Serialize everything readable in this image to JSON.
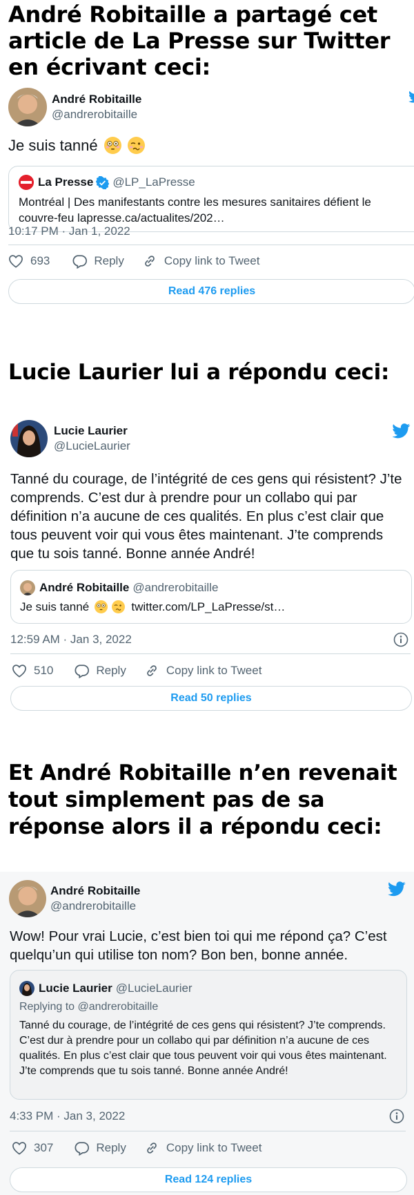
{
  "captions": {
    "first": "André Robitaille a partagé cet article de La Presse sur Twitter en écrivant ceci:",
    "second": "Lucie Laurier lui a répondu ceci:",
    "third": "Et André Robitaille n’en revenait tout simplement pas de sa réponse alors il a répondu ceci:"
  },
  "tweet1": {
    "name": "André Robitaille",
    "handle": "@andrerobitaille",
    "text": "Je suis tanné",
    "quote": {
      "name": "La Presse",
      "handle": "@LP_LaPresse",
      "text": "Montréal | Des manifestants contre les mesures sanitaires défient le couvre-feu lapresse.ca/actualites/202…"
    },
    "timestamp": "10:17 PM · Jan 1, 2022",
    "likes": "693",
    "reply_label": "Reply",
    "copy_label": "Copy link to Tweet",
    "read_label": "Read 476 replies"
  },
  "tweet2": {
    "name": "Lucie Laurier",
    "handle": "@LucieLaurier",
    "text": "Tanné du courage, de l’intégrité de ces gens qui résistent? J’te comprends. C’est dur à prendre pour un collabo qui par définition n’a aucune de ces qualités. En plus c’est clair que tous peuvent voir qui vous êtes maintenant. J’te comprends que tu sois tanné. Bonne année André!",
    "quote": {
      "name": "André Robitaille",
      "handle": "@andrerobitaille",
      "text_before": "Je suis tanné",
      "link": "twitter.com/LP_LaPresse/st…"
    },
    "timestamp": "12:59 AM · Jan 3, 2022",
    "likes": "510",
    "reply_label": "Reply",
    "copy_label": "Copy link to Tweet",
    "read_label": "Read 50 replies"
  },
  "tweet3": {
    "name": "André Robitaille",
    "handle": "@andrerobitaille",
    "text": "Wow! Pour vrai Lucie, c’est bien toi qui me répond ça? C’est quelqu’un qui utilise ton nom? Bon ben, bonne année.",
    "quote": {
      "name": "Lucie Laurier",
      "handle": "@LucieLaurier",
      "replying": "Replying to @andrerobitaille",
      "text": "Tanné du courage, de l’intégrité de ces gens qui résistent? J’te comprends. C’est dur à prendre pour un collabo qui par définition n’a aucune de ces qualités. En plus c’est clair que tous peuvent voir qui vous êtes maintenant. J’te comprends que tu sois tanné. Bonne année André!"
    },
    "timestamp": "4:33 PM · Jan 3, 2022",
    "likes": "307",
    "reply_label": "Reply",
    "copy_label": "Copy link to Tweet",
    "read_label": "Read 124 replies"
  },
  "icons": {
    "bird": "twitter-bird-icon",
    "heart": "heart-icon",
    "reply": "reply-bubble-icon",
    "link": "link-icon",
    "info": "info-icon",
    "verified": "verified-badge-icon",
    "flushed": "flushed-face-emoji",
    "woozy": "woozy-face-emoji"
  },
  "colors": {
    "twitter_blue": "#1d9bf0",
    "secondary_text": "#536471",
    "border": "#cfd9de",
    "la_presse_red": "#e4202c"
  }
}
